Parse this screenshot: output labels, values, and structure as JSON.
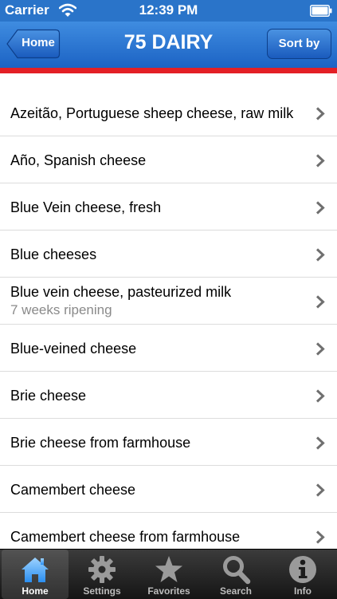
{
  "status_bar": {
    "carrier": "Carrier",
    "time": "12:39 PM",
    "wifi_icon": "wifi-icon",
    "battery_icon": "battery-icon"
  },
  "nav": {
    "home_label": "Home",
    "title": "75 DAIRY",
    "sort_label": "Sort by"
  },
  "colors": {
    "nav_blue": "#2a74c9",
    "accent_red": "#e32026",
    "tab_bar": "#1e1e1e"
  },
  "list": {
    "items": [
      {
        "title": "Azeitão, Portuguese sheep cheese, raw milk",
        "subtitle": ""
      },
      {
        "title": "Año, Spanish cheese",
        "subtitle": ""
      },
      {
        "title": "Blue Vein cheese, fresh",
        "subtitle": ""
      },
      {
        "title": "Blue cheeses",
        "subtitle": ""
      },
      {
        "title": "Blue vein cheese, pasteurized milk",
        "subtitle": "7 weeks ripening"
      },
      {
        "title": "Blue-veined cheese",
        "subtitle": ""
      },
      {
        "title": "Brie cheese",
        "subtitle": ""
      },
      {
        "title": "Brie cheese from farmhouse",
        "subtitle": ""
      },
      {
        "title": "Camembert cheese",
        "subtitle": ""
      },
      {
        "title": "Camembert cheese from farmhouse",
        "subtitle": ""
      }
    ]
  },
  "tabs": [
    {
      "label": "Home",
      "icon": "house-icon",
      "selected": true
    },
    {
      "label": "Settings",
      "icon": "gear-icon",
      "selected": false
    },
    {
      "label": "Favorites",
      "icon": "star-icon",
      "selected": false
    },
    {
      "label": "Search",
      "icon": "magnifier-icon",
      "selected": false
    },
    {
      "label": "Info",
      "icon": "info-icon",
      "selected": false
    }
  ]
}
